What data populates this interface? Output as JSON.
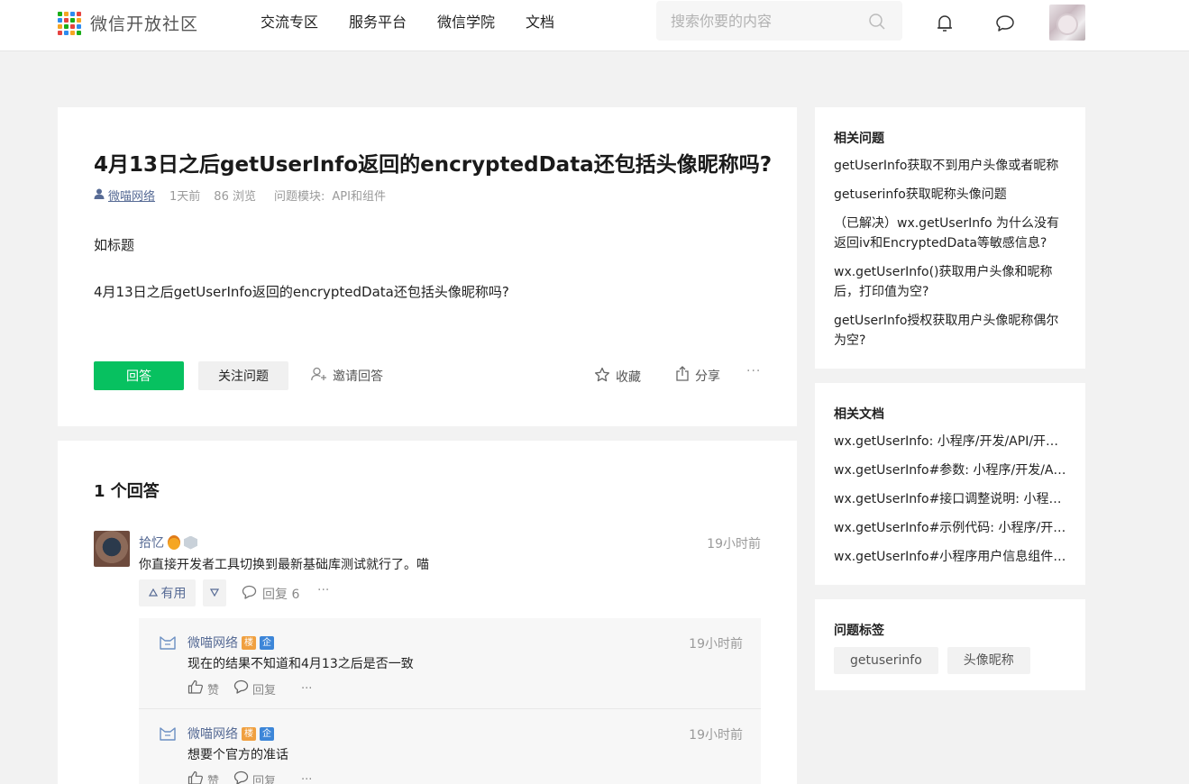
{
  "header": {
    "logo_text": "微信开放社区",
    "nav": [
      "交流专区",
      "服务平台",
      "微信学院",
      "文档"
    ],
    "search_placeholder": "搜索你要的内容"
  },
  "question": {
    "title": "4月13日之后getUserInfo返回的encryptedData还包括头像昵称吗?",
    "author": "微喵网络",
    "time": "1天前",
    "views": "86 浏览",
    "module_label": "问题模块:",
    "module": "API和组件",
    "body": [
      "如标题",
      "4月13日之后getUserInfo返回的encryptedData还包括头像昵称吗?"
    ],
    "answer_button": "回答",
    "follow_button": "关注问题",
    "invite_label": "邀请回答",
    "favorite_label": "收藏",
    "share_label": "分享",
    "more_label": "···"
  },
  "answers": {
    "count_label": "1 个回答",
    "items": [
      {
        "author": "拾忆",
        "time": "19小时前",
        "text": "你直接开发者工具切换到最新基础库测试就行了。喵",
        "useful_label": "有用",
        "reply_label": "回复 6",
        "more_label": "···",
        "replies": [
          {
            "author": "微喵网络",
            "tag_lou": "楼",
            "tag_qi": "企",
            "time": "19小时前",
            "text": "现在的结果不知道和4月13之后是否一致",
            "like_label": "赞",
            "reply_label": "回复",
            "more_label": "···"
          },
          {
            "author": "微喵网络",
            "tag_lou": "楼",
            "tag_qi": "企",
            "time": "19小时前",
            "text": "想要个官方的准话",
            "like_label": "赞",
            "reply_label": "回复",
            "more_label": "···"
          }
        ]
      }
    ]
  },
  "sidebar": {
    "related_questions": {
      "title": "相关问题",
      "items": [
        "getUserInfo获取不到用户头像或者昵称",
        "getuserinfo获取昵称头像问题",
        "（已解决）wx.getUserInfo 为什么没有返回iv和EncryptedData等敏感信息?",
        "wx.getUserInfo()获取用户头像和昵称后，打印值为空?",
        "getUserInfo授权获取用户头像昵称偶尔为空?"
      ]
    },
    "related_docs": {
      "title": "相关文档",
      "items": [
        "wx.getUserInfo: 小程序/开发/API/开放...",
        "wx.getUserInfo#参数: 小程序/开发/API...",
        "wx.getUserInfo#接口调整说明: 小程序/...",
        "wx.getUserInfo#示例代码: 小程序/开发...",
        "wx.getUserInfo#小程序用户信息组件示..."
      ]
    },
    "tags": {
      "title": "问题标签",
      "items": [
        "getuserinfo",
        "头像昵称"
      ]
    }
  },
  "colors": {
    "brand_green": "#07c160",
    "link_blue": "#576b95"
  }
}
